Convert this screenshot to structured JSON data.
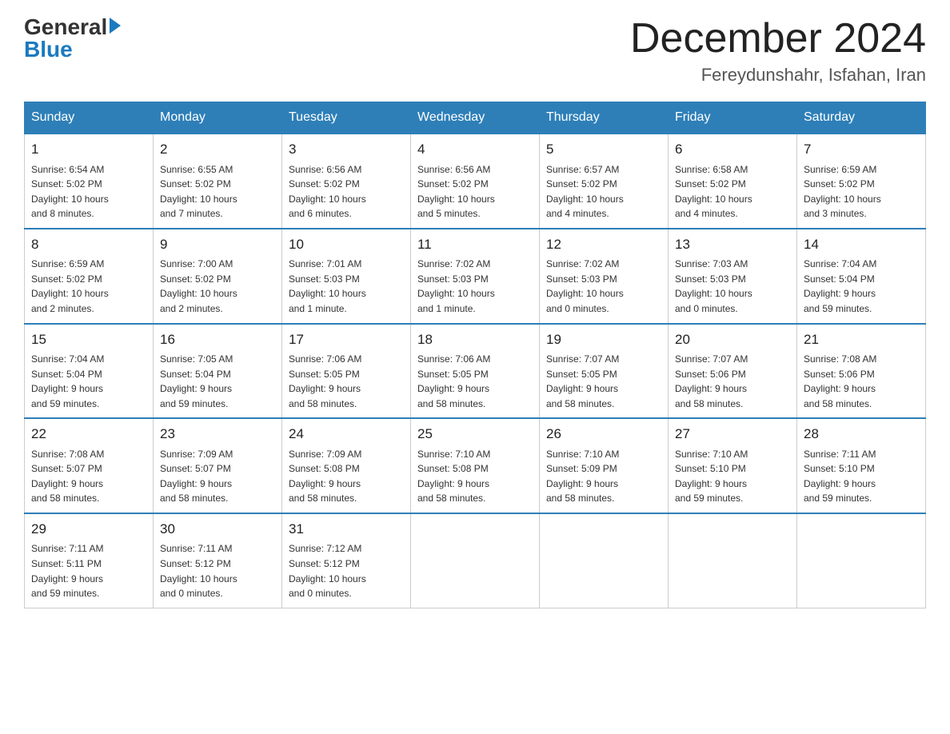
{
  "header": {
    "logo_general": "General",
    "logo_blue": "Blue",
    "month_year": "December 2024",
    "location": "Fereydunshahr, Isfahan, Iran"
  },
  "days_of_week": [
    "Sunday",
    "Monday",
    "Tuesday",
    "Wednesday",
    "Thursday",
    "Friday",
    "Saturday"
  ],
  "weeks": [
    [
      {
        "day": "1",
        "info": "Sunrise: 6:54 AM\nSunset: 5:02 PM\nDaylight: 10 hours\nand 8 minutes."
      },
      {
        "day": "2",
        "info": "Sunrise: 6:55 AM\nSunset: 5:02 PM\nDaylight: 10 hours\nand 7 minutes."
      },
      {
        "day": "3",
        "info": "Sunrise: 6:56 AM\nSunset: 5:02 PM\nDaylight: 10 hours\nand 6 minutes."
      },
      {
        "day": "4",
        "info": "Sunrise: 6:56 AM\nSunset: 5:02 PM\nDaylight: 10 hours\nand 5 minutes."
      },
      {
        "day": "5",
        "info": "Sunrise: 6:57 AM\nSunset: 5:02 PM\nDaylight: 10 hours\nand 4 minutes."
      },
      {
        "day": "6",
        "info": "Sunrise: 6:58 AM\nSunset: 5:02 PM\nDaylight: 10 hours\nand 4 minutes."
      },
      {
        "day": "7",
        "info": "Sunrise: 6:59 AM\nSunset: 5:02 PM\nDaylight: 10 hours\nand 3 minutes."
      }
    ],
    [
      {
        "day": "8",
        "info": "Sunrise: 6:59 AM\nSunset: 5:02 PM\nDaylight: 10 hours\nand 2 minutes."
      },
      {
        "day": "9",
        "info": "Sunrise: 7:00 AM\nSunset: 5:02 PM\nDaylight: 10 hours\nand 2 minutes."
      },
      {
        "day": "10",
        "info": "Sunrise: 7:01 AM\nSunset: 5:03 PM\nDaylight: 10 hours\nand 1 minute."
      },
      {
        "day": "11",
        "info": "Sunrise: 7:02 AM\nSunset: 5:03 PM\nDaylight: 10 hours\nand 1 minute."
      },
      {
        "day": "12",
        "info": "Sunrise: 7:02 AM\nSunset: 5:03 PM\nDaylight: 10 hours\nand 0 minutes."
      },
      {
        "day": "13",
        "info": "Sunrise: 7:03 AM\nSunset: 5:03 PM\nDaylight: 10 hours\nand 0 minutes."
      },
      {
        "day": "14",
        "info": "Sunrise: 7:04 AM\nSunset: 5:04 PM\nDaylight: 9 hours\nand 59 minutes."
      }
    ],
    [
      {
        "day": "15",
        "info": "Sunrise: 7:04 AM\nSunset: 5:04 PM\nDaylight: 9 hours\nand 59 minutes."
      },
      {
        "day": "16",
        "info": "Sunrise: 7:05 AM\nSunset: 5:04 PM\nDaylight: 9 hours\nand 59 minutes."
      },
      {
        "day": "17",
        "info": "Sunrise: 7:06 AM\nSunset: 5:05 PM\nDaylight: 9 hours\nand 58 minutes."
      },
      {
        "day": "18",
        "info": "Sunrise: 7:06 AM\nSunset: 5:05 PM\nDaylight: 9 hours\nand 58 minutes."
      },
      {
        "day": "19",
        "info": "Sunrise: 7:07 AM\nSunset: 5:05 PM\nDaylight: 9 hours\nand 58 minutes."
      },
      {
        "day": "20",
        "info": "Sunrise: 7:07 AM\nSunset: 5:06 PM\nDaylight: 9 hours\nand 58 minutes."
      },
      {
        "day": "21",
        "info": "Sunrise: 7:08 AM\nSunset: 5:06 PM\nDaylight: 9 hours\nand 58 minutes."
      }
    ],
    [
      {
        "day": "22",
        "info": "Sunrise: 7:08 AM\nSunset: 5:07 PM\nDaylight: 9 hours\nand 58 minutes."
      },
      {
        "day": "23",
        "info": "Sunrise: 7:09 AM\nSunset: 5:07 PM\nDaylight: 9 hours\nand 58 minutes."
      },
      {
        "day": "24",
        "info": "Sunrise: 7:09 AM\nSunset: 5:08 PM\nDaylight: 9 hours\nand 58 minutes."
      },
      {
        "day": "25",
        "info": "Sunrise: 7:10 AM\nSunset: 5:08 PM\nDaylight: 9 hours\nand 58 minutes."
      },
      {
        "day": "26",
        "info": "Sunrise: 7:10 AM\nSunset: 5:09 PM\nDaylight: 9 hours\nand 58 minutes."
      },
      {
        "day": "27",
        "info": "Sunrise: 7:10 AM\nSunset: 5:10 PM\nDaylight: 9 hours\nand 59 minutes."
      },
      {
        "day": "28",
        "info": "Sunrise: 7:11 AM\nSunset: 5:10 PM\nDaylight: 9 hours\nand 59 minutes."
      }
    ],
    [
      {
        "day": "29",
        "info": "Sunrise: 7:11 AM\nSunset: 5:11 PM\nDaylight: 9 hours\nand 59 minutes."
      },
      {
        "day": "30",
        "info": "Sunrise: 7:11 AM\nSunset: 5:12 PM\nDaylight: 10 hours\nand 0 minutes."
      },
      {
        "day": "31",
        "info": "Sunrise: 7:12 AM\nSunset: 5:12 PM\nDaylight: 10 hours\nand 0 minutes."
      },
      {
        "day": "",
        "info": ""
      },
      {
        "day": "",
        "info": ""
      },
      {
        "day": "",
        "info": ""
      },
      {
        "day": "",
        "info": ""
      }
    ]
  ]
}
